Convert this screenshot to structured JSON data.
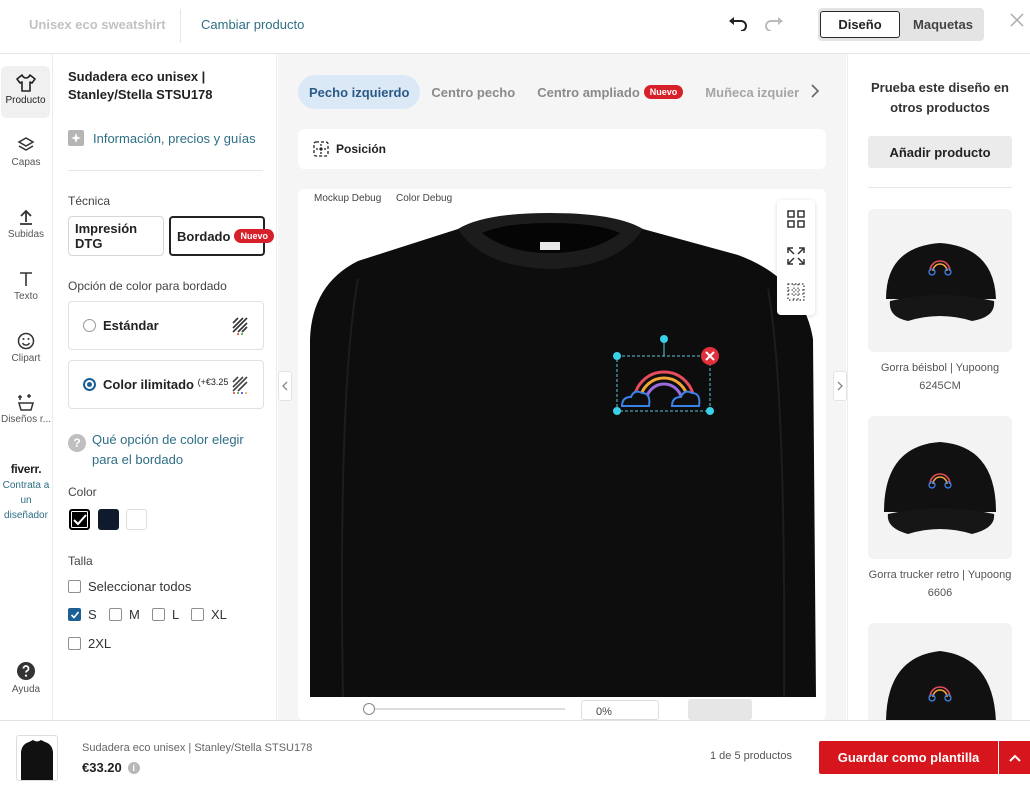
{
  "topbar": {
    "project_title": "Unisex eco sweatshirt",
    "change_product": "Cambiar producto",
    "tabs": [
      "Diseño",
      "Maquetas"
    ]
  },
  "nav": {
    "items": [
      "Producto",
      "Capas",
      "Subidas",
      "Texto",
      "Clipart",
      "Diseños r...",
      "Ayuda"
    ],
    "fiverr_logo": "fiverr.",
    "fiverr_text": "Contrata a un diseñador"
  },
  "panel": {
    "product_name": "Sudadera eco unisex | Stanley/Stella STSU178",
    "info_link": "Información, precios y guías",
    "technique_label": "Técnica",
    "techniques": [
      "Impresión DTG",
      "Bordado"
    ],
    "new_badge": "Nuevo",
    "color_option_label": "Opción de color para bordado",
    "color_options": [
      {
        "label": "Estándar",
        "extra": ""
      },
      {
        "label": "Color ilimitado",
        "extra": "(+€3.25"
      }
    ],
    "help_link": "Qué opción de color elegir para el bordado",
    "color_label": "Color",
    "colors": [
      "#000000",
      "#0f1a2c",
      "#ffffff"
    ],
    "size_label": "Talla",
    "select_all": "Seleccionar todos",
    "sizes": [
      "S",
      "M",
      "L",
      "XL",
      "2XL"
    ]
  },
  "canvas": {
    "positions": [
      "Pecho izquierdo",
      "Centro pecho",
      "Centro ampliado",
      "Muñeca izquier"
    ],
    "new_badge": "Nuevo",
    "position_button": "Posición",
    "debug_labels": [
      "Mockup Debug",
      "Color Debug"
    ],
    "zoom": "0%"
  },
  "right": {
    "title": "Prueba este diseño en otros productos",
    "add_button": "Añadir producto",
    "products": [
      "Gorra béisbol | Yupoong 6245CM",
      "Gorra trucker retro | Yupoong 6606"
    ]
  },
  "footer": {
    "product_name": "Sudadera eco unisex | Stanley/Stella STSU178",
    "price": "€33.20",
    "count": "1 de 5 productos",
    "save_button": "Guardar como plantilla"
  }
}
